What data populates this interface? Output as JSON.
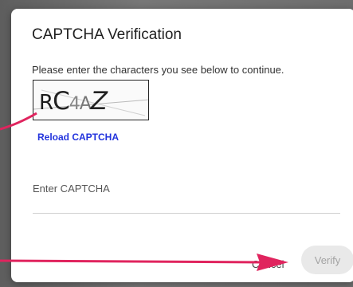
{
  "dialog": {
    "title": "CAPTCHA Verification",
    "instructions": "Please enter the characters you see below to continue.",
    "captcha": {
      "chars": [
        "R",
        "C",
        "4",
        "A",
        "Z"
      ]
    },
    "reload_label": "Reload CAPTCHA",
    "input": {
      "label": "Enter CAPTCHA",
      "value": ""
    },
    "cancel_label": "Cancel",
    "verify_label": "Verify"
  },
  "colors": {
    "link": "#2233dd",
    "annotation_arrow": "#e0245e",
    "verify_disabled_bg": "#e9e9e9",
    "verify_disabled_text": "#a3a3a3"
  }
}
